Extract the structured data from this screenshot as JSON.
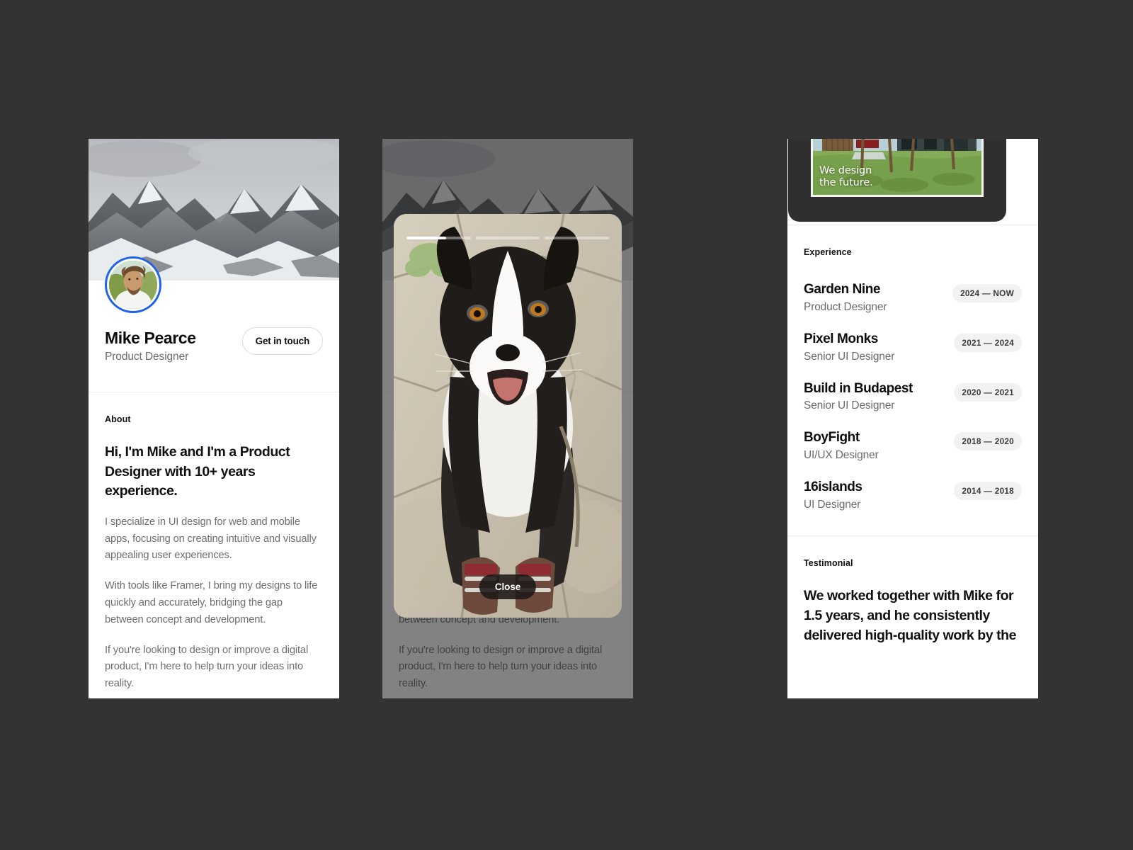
{
  "theme": {
    "page_background": "#333333",
    "accent_ring": "#1f64e8",
    "card_dark": "#2f2f2f",
    "badge_bg": "#f2f2f2",
    "muted_text": "#6c6c6c"
  },
  "profile": {
    "name": "Mike Pearce",
    "role": "Product Designer",
    "cta_label": "Get in touch",
    "avatar_alt": "avatar"
  },
  "about": {
    "label": "About",
    "lead": "Hi, I'm Mike and I'm a Product Designer with 10+ years experience.",
    "paragraphs": [
      "I specialize in UI design for web and mobile apps, focusing on creating intuitive and visually appealing user experiences.",
      "With tools like Framer, I bring my designs to life quickly and accurately, bridging the gap between concept and development.",
      "If you're looking to design or improve a digital product, I'm here to help turn your ideas into reality."
    ]
  },
  "viewer": {
    "close_label": "Close",
    "progress": [
      {
        "fill_percent": 62
      },
      {
        "fill_percent": 0
      },
      {
        "fill_percent": 0
      }
    ],
    "photo_alt": "border collie dog"
  },
  "project_card": {
    "caption_line1": "We design",
    "caption_line2": "the future.",
    "photo_alt": "modern house with lawn and trees"
  },
  "experience": {
    "label": "Experience",
    "items": [
      {
        "company": "Garden Nine",
        "role": "Product Designer",
        "period": "2024 — NOW"
      },
      {
        "company": "Pixel Monks",
        "role": "Senior UI Designer",
        "period": "2021 — 2024"
      },
      {
        "company": "Build in Budapest",
        "role": "Senior UI Designer",
        "period": "2020 — 2021"
      },
      {
        "company": "BoyFight",
        "role": "UI/UX Designer",
        "period": "2018 — 2020"
      },
      {
        "company": "16islands",
        "role": "UI Designer",
        "period": "2014 — 2018"
      }
    ]
  },
  "testimonial": {
    "label": "Testimonial",
    "quote": "We worked together with Mike for 1.5 years, and he consistently delivered high-quality work by the"
  }
}
